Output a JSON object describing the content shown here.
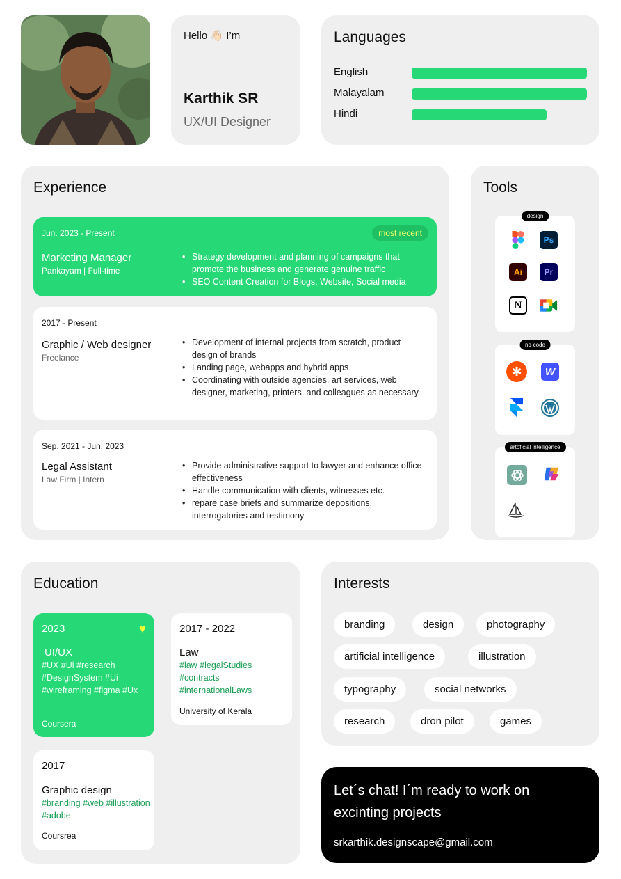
{
  "profile": {
    "greeting": "Hello 👋🏻 I’m",
    "name": "Karthik SR",
    "role": "UX/UI Designer"
  },
  "languages": {
    "title": "Languages",
    "items": [
      {
        "name": "English",
        "level": 1.0
      },
      {
        "name": "Malayalam",
        "level": 1.0
      },
      {
        "name": "Hindi",
        "level": 0.77
      }
    ]
  },
  "experience": {
    "title": "Experience",
    "items": [
      {
        "period": "Jun. 2023 - Present",
        "badge": "most recent",
        "title": "Marketing Manager",
        "subtitle": "Pankayam   |   Full-time",
        "bullets": [
          "Strategy development and planning of campaigns that promote the business and generate genuine traffic",
          "SEO Content Creation for Blogs, Website, Social media"
        ]
      },
      {
        "period": "2017 - Present",
        "title": "Graphic / Web designer",
        "subtitle": "Freelance",
        "bullets": [
          "Development of internal projects from scratch, product design of brands",
          "Landing page, webapps and hybrid apps",
          "Coordinating with outside agencies, art services, web designer, marketing, printers, and colleagues as necessary."
        ]
      },
      {
        "period": "Sep. 2021 - Jun. 2023",
        "title": "Legal Assistant",
        "subtitle": "Law Firm   |   Intern",
        "bullets": [
          "Provide administrative support to lawyer and enhance office effectiveness",
          "Handle communication with clients, witnesses etc.",
          "repare case briefs and summarize depositions, interrogatories and testimony"
        ]
      }
    ]
  },
  "tools": {
    "title": "Tools",
    "groups": [
      {
        "tag": "design",
        "icons": [
          "figma-icon",
          "photoshop-icon",
          "illustrator-icon",
          "premiere-icon",
          "notion-icon",
          "google-meet-icon"
        ]
      },
      {
        "tag": "no-code",
        "icons": [
          "zapier-icon",
          "webflow-icon",
          "framer-icon",
          "wordpress-icon"
        ]
      },
      {
        "tag": "artoficial intelligence",
        "icons": [
          "chatgpt-icon",
          "copilot-icon",
          "midjourney-icon"
        ]
      }
    ],
    "labels": {
      "ps": "Ps",
      "ai": "Ai",
      "pr": "Pr",
      "n": "N",
      "w": "W"
    }
  },
  "education": {
    "title": "Education",
    "items": [
      {
        "year": "2023",
        "title": "UI/UX",
        "tags": "#UX #Ui #research #DesignSystem #Ui #wireframing #figma #Ux",
        "school": "Coursera"
      },
      {
        "year": "2017 - 2022",
        "title": "Law",
        "tags": "#law #legalStudies #contracts #internationalLaws",
        "school": "University of Kerala"
      },
      {
        "year": "2017",
        "title": "Graphic design",
        "tags": "#branding #web #illustration #adobe",
        "school": "Coursrea"
      }
    ]
  },
  "interests": {
    "title": "Interests",
    "items": [
      "branding",
      "design",
      "photography",
      "artificial intelligence",
      "illustration",
      "typography",
      "social networks",
      "research",
      "dron pilot",
      "games"
    ]
  },
  "contact": {
    "message": "Let´s chat! I´m ready to work on excinting projects",
    "email": "srkarthik.designscape@gmail.com"
  },
  "colors": {
    "accent": "#27d877",
    "card": "#efefef",
    "dark": "#000000"
  }
}
